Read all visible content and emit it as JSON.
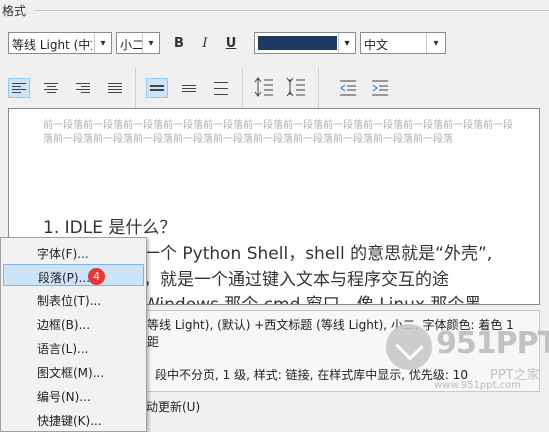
{
  "format_section": {
    "title": "格式"
  },
  "font_toolbar": {
    "font_name": "等线 Light (中文",
    "font_size": "小二",
    "bold": "B",
    "italic": "I",
    "underline": "U",
    "font_color": "#1f3864",
    "language": "中文"
  },
  "preview": {
    "sample_prev": "前一段落前一段落前一段落前一段落前一段落前一段落前一段落前一段落前一段落前一段落前一段落前一段落前一段落前一段落前一段落前一段落前一段落前一段落前一段落前一段落前一段落前一段落",
    "heading": "1. IDLE  是什么？",
    "line2": "一个 Python Shell，shell 的意思就是“外壳”,",
    "line3": "，就是一个通过键入文本与程序交互的途",
    "line4": "Windows 那个 cmd 窗口，像 Linux 那个黑"
  },
  "description": {
    "line1": "等线 Light), (默认) +西文标题 (等线 Light), 小二, 字体颜色: 着色 1",
    "line2": "距",
    "line3": "段中不分页, 1 级, 样式: 链接, 在样式库中显示, 优先级: 10"
  },
  "options": {
    "auto_update": "动更新(U)"
  },
  "context_menu": {
    "items": [
      {
        "label": "字体(F)..."
      },
      {
        "label": "段落(P)..."
      },
      {
        "label": "制表位(T)..."
      },
      {
        "label": "边框(B)..."
      },
      {
        "label": "语言(L)..."
      },
      {
        "label": "图文框(M)..."
      },
      {
        "label": "编号(N)..."
      },
      {
        "label": "快捷键(K)..."
      }
    ],
    "badge": "4"
  },
  "watermark": {
    "brand": "951PPT",
    "brand_cn": "PPT之家",
    "url": "www.951ppt.com"
  },
  "colors": {
    "accent": "#cce4f7",
    "badge": "#e53935",
    "font_color": "#1f3864"
  }
}
